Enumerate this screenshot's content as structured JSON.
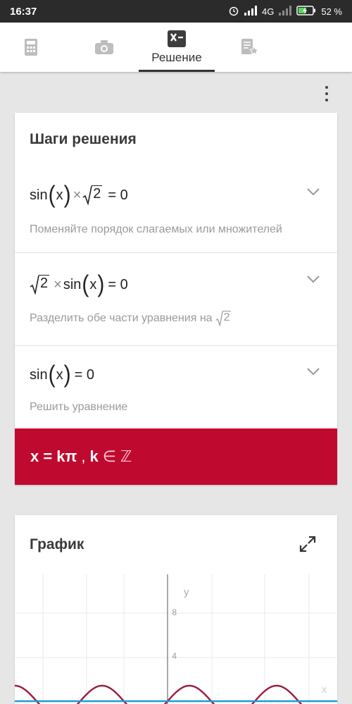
{
  "status": {
    "time": "16:37",
    "network": "4G",
    "battery": "52 %"
  },
  "tabs": [
    {
      "icon": "calculator-icon",
      "label": ""
    },
    {
      "icon": "camera-icon",
      "label": ""
    },
    {
      "icon": "solution-icon",
      "label": "Решение"
    },
    {
      "icon": "bookmarks-icon",
      "label": ""
    }
  ],
  "steps_card": {
    "title": "Шаги решения",
    "steps": [
      {
        "expr": {
          "fn": "sin",
          "arg": "x",
          "times": "×",
          "rad": "2",
          "rhs": "= 0"
        },
        "hint": "Поменяйте порядок слагаемых или множителей"
      },
      {
        "expr": {
          "rad": "2",
          "times": "×",
          "fn": "sin",
          "arg": "x",
          "rhs": "= 0"
        },
        "hint": "Разделить обе части уравнения на",
        "hint_rad": "2"
      },
      {
        "expr": {
          "fn": "sin",
          "arg": "x",
          "rhs": "= 0"
        },
        "hint": "Решить уравнение"
      }
    ],
    "result": {
      "lhs": "x = kπ",
      "sep": ",",
      "k": "k",
      "member": "∈ ℤ"
    }
  },
  "graph_card": {
    "title": "График"
  },
  "chart_data": {
    "type": "line",
    "title": "",
    "xlabel": "x",
    "ylabel": "y",
    "y_ticks": [
      "8",
      "4"
    ],
    "series": [
      {
        "name": "",
        "function": "sin(x)·√2",
        "color": "#9b1b3a"
      },
      {
        "name": "",
        "function": "y = 0",
        "color": "#1e9bd7"
      }
    ],
    "grid": true
  },
  "colors": {
    "accent": "#c0092f",
    "curve": "#9b1b3a",
    "axis_line": "#1e9bd7"
  }
}
